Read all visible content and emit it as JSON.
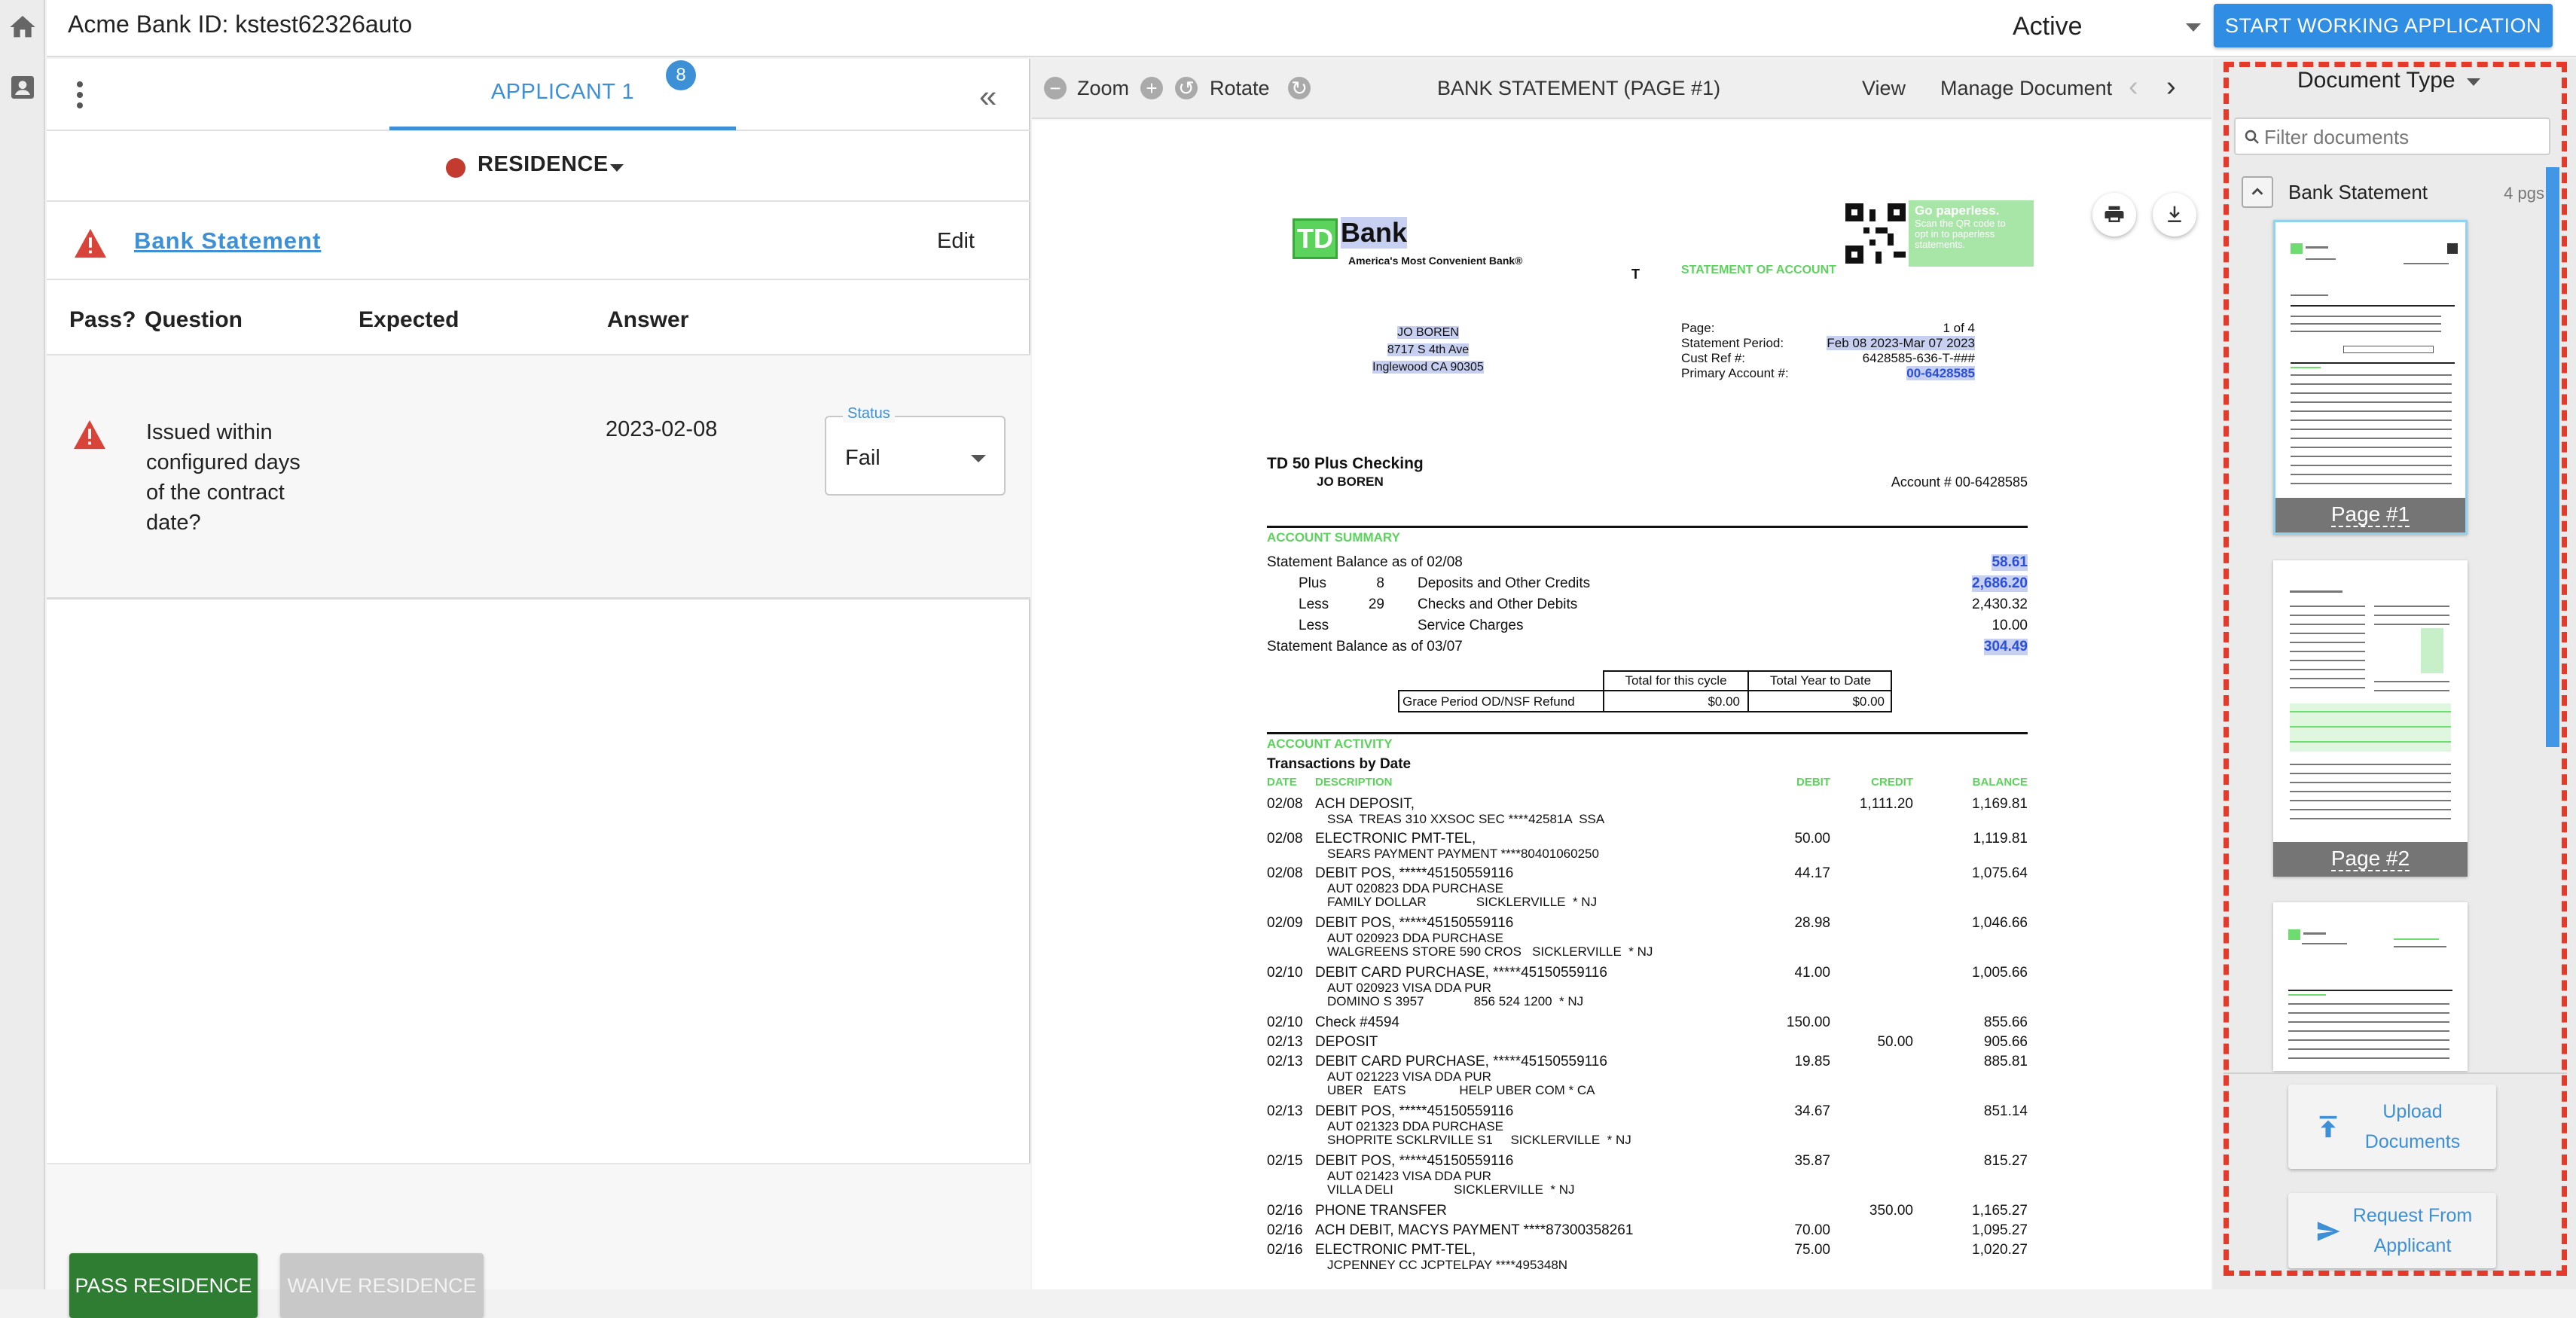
{
  "rail": {
    "home_icon": "home-icon",
    "profile_icon": "contact-card-icon"
  },
  "header": {
    "title": "Acme Bank ID:  kstest62326auto",
    "status_value": "Active",
    "start_button": "START WORKING APPLICATION"
  },
  "applicant": {
    "tab_label": "APPLICANT 1",
    "badge_count": "8",
    "category": "RESIDENCE",
    "document_name": "Bank Statement",
    "edit_label": "Edit",
    "columns": {
      "pass": "Pass?",
      "question": "Question",
      "expected": "Expected",
      "answer": "Answer"
    },
    "question": {
      "text": "Issued within configured days of the contract date?",
      "expected": "",
      "answer": "2023-02-08",
      "status_label": "Status",
      "status_value": "Fail"
    },
    "pass_button": "PASS RESIDENCE",
    "waive_button": "WAIVE RESIDENCE"
  },
  "viewer": {
    "zoom_label": "Zoom",
    "rotate_label": "Rotate",
    "title": "BANK STATEMENT (PAGE #1)",
    "view_label": "View",
    "manage_label": "Manage Document"
  },
  "statement": {
    "bank_logo": "TD",
    "bank_name": "Bank",
    "tagline": "America's Most Convenient Bank®",
    "paperless": [
      "Go paperless.",
      "Scan the QR code to",
      "opt in to paperless",
      "statements."
    ],
    "heading": "STATEMENT OF ACCOUNT",
    "customer": [
      "JO BOREN",
      "8717 S 4th Ave",
      "Inglewood CA 90305"
    ],
    "meta_labels": [
      "Page:",
      "Statement Period:",
      "Cust Ref #:",
      "Primary Account #:"
    ],
    "meta_values": [
      "1 of 4",
      "Feb 08 2023-Mar 07 2023",
      "6428585-636-T-###",
      "00-6428585"
    ],
    "product": "TD 50 Plus Checking",
    "holder": "JO BOREN",
    "account_no": "Account # 00-6428585",
    "summary_title": "ACCOUNT SUMMARY",
    "summary": [
      {
        "label": "Statement Balance as of 02/08",
        "value": "58.61"
      },
      {
        "kind": "Plus",
        "count": "8",
        "label": "Deposits and Other Credits",
        "value": "2,686.20"
      },
      {
        "kind": "Less",
        "count": "29",
        "label": "Checks and Other Debits",
        "value": "2,430.32"
      },
      {
        "kind": "Less",
        "count": "",
        "label": "Service Charges",
        "value": "10.00"
      },
      {
        "label": "Statement Balance as of 03/07",
        "value": "304.49"
      }
    ],
    "grace": {
      "col1": "Total for this cycle",
      "col2": "Total Year to Date",
      "label": "Grace Period OD/NSF Refund",
      "v1": "$0.00",
      "v2": "$0.00"
    },
    "activity_title": "ACCOUNT ACTIVITY",
    "transactions_title": "Transactions by Date",
    "columns": {
      "date": "DATE",
      "desc": "DESCRIPTION",
      "debit": "DEBIT",
      "credit": "CREDIT",
      "balance": "BALANCE"
    },
    "transactions": [
      {
        "date": "02/08",
        "desc": "ACH DEPOSIT,",
        "sub": "SSA  TREAS 310 XXSOC SEC ****42581A  SSA",
        "sub2": "",
        "debit": "",
        "credit": "1,111.20",
        "balance": "1,169.81"
      },
      {
        "date": "02/08",
        "desc": "ELECTRONIC PMT-TEL,",
        "sub": "SEARS PAYMENT PAYMENT ****80401060250",
        "sub2": "",
        "debit": "50.00",
        "credit": "",
        "balance": "1,119.81"
      },
      {
        "date": "02/08",
        "desc": "DEBIT POS, *****45150559116",
        "sub": "AUT 020823 DDA PURCHASE",
        "sub2": "FAMILY DOLLAR              SICKLERVILLE  * NJ",
        "debit": "44.17",
        "credit": "",
        "balance": "1,075.64"
      },
      {
        "date": "02/09",
        "desc": "DEBIT POS, *****45150559116",
        "sub": "AUT 020923 DDA PURCHASE",
        "sub2": "WALGREENS STORE 590 CROS   SICKLERVILLE  * NJ",
        "debit": "28.98",
        "credit": "",
        "balance": "1,046.66"
      },
      {
        "date": "02/10",
        "desc": "DEBIT CARD PURCHASE, *****45150559116",
        "sub": "AUT 020923 VISA DDA PUR",
        "sub2": "DOMINO S 3957              856 524 1200  * NJ",
        "debit": "41.00",
        "credit": "",
        "balance": "1,005.66"
      },
      {
        "date": "02/10",
        "desc": "Check #4594",
        "sub": "",
        "sub2": "",
        "debit": "150.00",
        "credit": "",
        "balance": "855.66"
      },
      {
        "date": "02/13",
        "desc": "DEPOSIT",
        "sub": "",
        "sub2": "",
        "debit": "",
        "credit": "50.00",
        "balance": "905.66"
      },
      {
        "date": "02/13",
        "desc": "DEBIT CARD PURCHASE, *****45150559116",
        "sub": "AUT 021223 VISA DDA PUR",
        "sub2": "UBER   EATS               HELP UBER COM * CA",
        "debit": "19.85",
        "credit": "",
        "balance": "885.81"
      },
      {
        "date": "02/13",
        "desc": "DEBIT POS, *****45150559116",
        "sub": "AUT 021323 DDA PURCHASE",
        "sub2": "SHOPRITE SCKLRVILLE S1     SICKLERVILLE  * NJ",
        "debit": "34.67",
        "credit": "",
        "balance": "851.14"
      },
      {
        "date": "02/15",
        "desc": "DEBIT POS, *****45150559116",
        "sub": "AUT 021423 VISA DDA PUR",
        "sub2": "VILLA DELI                 SICKLERVILLE  * NJ",
        "debit": "35.87",
        "credit": "",
        "balance": "815.27"
      },
      {
        "date": "02/16",
        "desc": "PHONE TRANSFER",
        "sub": "",
        "sub2": "",
        "debit": "",
        "credit": "350.00",
        "balance": "1,165.27"
      },
      {
        "date": "02/16",
        "desc": "ACH DEBIT, MACYS PAYMENT ****87300358261",
        "sub": "",
        "sub2": "",
        "debit": "70.00",
        "credit": "",
        "balance": "1,095.27"
      },
      {
        "date": "02/16",
        "desc": "ELECTRONIC PMT-TEL,",
        "sub": "JCPENNEY CC JCPTELPAY ****495348N",
        "sub2": "",
        "debit": "75.00",
        "credit": "",
        "balance": "1,020.27"
      }
    ]
  },
  "documents": {
    "type_label": "Document Type",
    "filter_placeholder": "Filter documents",
    "group_name": "Bank Statement",
    "group_count": "4 pgs",
    "pages": [
      "Page #1",
      "Page #2"
    ],
    "upload_label": "Upload Documents",
    "request_label": "Request From Applicant"
  },
  "colors": {
    "primary": "#2f8de4",
    "pass_green": "#2e7d32",
    "fail_red": "#c33a2f",
    "frame_red": "#e53a2a",
    "statement_green": "#5cd35c"
  }
}
